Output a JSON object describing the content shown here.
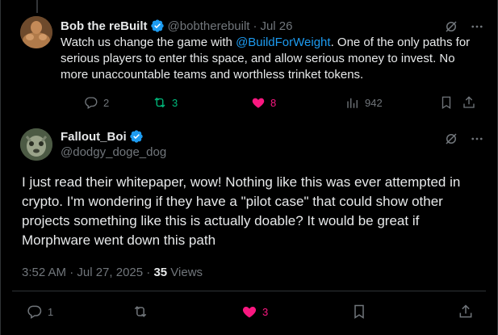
{
  "reply": {
    "author_name": "Bob the reBuilt",
    "handle": "@bobtherebuilt",
    "separator": "·",
    "date": "Jul 26",
    "text_before_link": "Watch us change the game with ",
    "link_text": "@BuildForWeight",
    "text_after_link": ". One of the only paths for serious players to enter this space, and allow serious money to invest. No more unaccountable teams and worthless trinket tokens.",
    "replies": "2",
    "reposts": "3",
    "likes": "8",
    "views": "942"
  },
  "tweet": {
    "author_name": "Fallout_Boi",
    "handle": "@dodgy_doge_dog",
    "text": "I just read their whitepaper, wow! Nothing like this was ever attempted in crypto. I'm wondering if they have a \"pilot case\" that could show other projects something like this is actually doable? It would be great if Morphware went down this path",
    "time": "3:52 AM · Jul 27, 2025 · ",
    "view_count": "35",
    "views_label": " Views",
    "replies": "1",
    "likes": "3"
  },
  "colors": {
    "background": "#000000",
    "text": "#e7e9ea",
    "muted": "#71767b",
    "link": "#1d9bf0",
    "verified": "#1d9bf0",
    "repost_active": "#00ba7c",
    "like_active": "#f91880",
    "divider": "#2f3336"
  }
}
